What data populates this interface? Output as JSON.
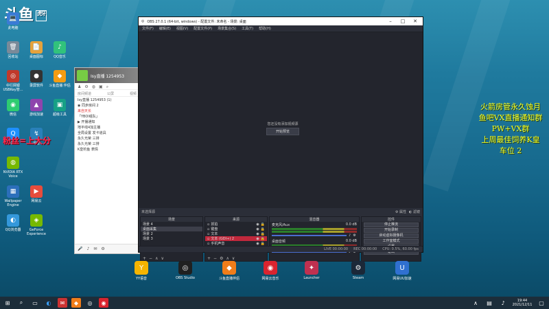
{
  "brand_overlay": {
    "text": "斗鱼",
    "box": "虎牙"
  },
  "overlay_left": "粉丝=上大分",
  "overlay_right": [
    "火箭房管永久蚀月",
    "鱼吧VX直播通知群",
    "PW+VX群",
    "上周最佳饲养K皇",
    "车位 2"
  ],
  "desktop_icons": [
    {
      "label": "此电脑",
      "icon": "💻",
      "color": "#3a7bd5"
    },
    {
      "label": "回收站",
      "icon": "🗑",
      "color": "#7a8a99"
    },
    {
      "label": "桌面图标",
      "icon": "📄",
      "color": "#e6a23c"
    },
    {
      "label": "QQ音乐",
      "icon": "♪",
      "color": "#31c27c"
    },
    {
      "label": "中行网银 USBKey管...",
      "icon": "◎",
      "color": "#c0392b"
    },
    {
      "label": "录屏软件",
      "icon": "●",
      "color": "#333"
    },
    {
      "label": "斗鱼直播 伴侣",
      "icon": "◆",
      "color": "#f39c12"
    },
    {
      "label": "微信",
      "icon": "◉",
      "color": "#2ecc71"
    },
    {
      "label": "游戏加速",
      "icon": "▲",
      "color": "#8e44ad"
    },
    {
      "label": "超级工具",
      "icon": "▣",
      "color": "#16a085"
    },
    {
      "label": "QQ",
      "icon": "Q",
      "color": "#1e90ff"
    },
    {
      "label": "迅雷",
      "icon": "↯",
      "color": "#2980b9"
    },
    {
      "label": "NVIDIA RTX Voice",
      "icon": "◍",
      "color": "#76b900"
    },
    {
      "label": "Wallpaper Engine",
      "icon": "▦",
      "color": "#2c6fbb"
    },
    {
      "label": "QQ浏览器",
      "icon": "◐",
      "color": "#3498db"
    },
    {
      "label": "GeForce Experience",
      "icon": "◈",
      "color": "#76b900"
    },
    {
      "label": "网易云",
      "icon": "▶",
      "color": "#e74c3c"
    }
  ],
  "dock_icons": [
    {
      "label": "YY语音",
      "icon": "Y",
      "color": "#f5b400"
    },
    {
      "label": "OBS Studio",
      "icon": "◎",
      "color": "#202020"
    },
    {
      "label": "斗鱼直播伴侣",
      "icon": "◆",
      "color": "#f07d1a"
    },
    {
      "label": "网易云音乐",
      "icon": "◉",
      "color": "#d9242f"
    },
    {
      "label": "Launcher",
      "icon": "✦",
      "color": "#c03050"
    },
    {
      "label": "Steam",
      "icon": "⚙",
      "color": "#1b2838"
    },
    {
      "label": "网易UU加速",
      "icon": "U",
      "color": "#3070d0"
    }
  ],
  "yy": {
    "title": "Isy直播  1254953",
    "tabs": [
      "房间频道",
      "公屏",
      "视频"
    ],
    "lines": [
      "Isy直播 1254953 (1)",
      "◉ 同步房间 2",
      "来自天长",
      "「YBOl组队」",
      "▶ 开播通知",
      "地平线4加主播",
      "全局设置  发卡道具",
      "永久光荣 三排",
      "永久光荣 三排",
      "K皇钓鱼 表情"
    ]
  },
  "obs": {
    "title": "OBS 27.0.1 (64-bit, windows) - 配置文件: 未命名 - 场景: 桌面",
    "menu": [
      "文件(F)",
      "编辑(E)",
      "视图(V)",
      "配置文件(P)",
      "场景集合(S)",
      "工具(T)",
      "帮助(H)"
    ],
    "preview_msg": "您还没有添加视频源",
    "preview_btn": "开始预览",
    "source_label": "未选择源",
    "props_btn": "属性",
    "filters_btn": "滤镜",
    "scenes_title": "场景",
    "sources_title": "来源",
    "mixer_title": "混音器",
    "controls_title": "控件",
    "scenes": [
      "场景 4",
      "桌面采集",
      "场景 2",
      "场景 3"
    ],
    "sources": [
      "抓拍",
      "键盘",
      "文本",
      "文本 (GDI+) 2",
      "手机声音",
      "显示器采集"
    ],
    "mixer": [
      {
        "name": "麦克风/Aux",
        "db": "0.0 dB"
      },
      {
        "name": "桌面音频",
        "db": "0.0 dB"
      }
    ],
    "controls": [
      "停止推流",
      "开始录制",
      "启动虚拟摄像机",
      "工作室模式",
      "设置",
      "退出"
    ],
    "status": [
      "LIVE 00:00:00",
      "REC 00:00:00",
      "CPU: 0.5%, 60.00 fps"
    ]
  },
  "clock": {
    "time": "19:44",
    "date": "2021/12/11"
  }
}
